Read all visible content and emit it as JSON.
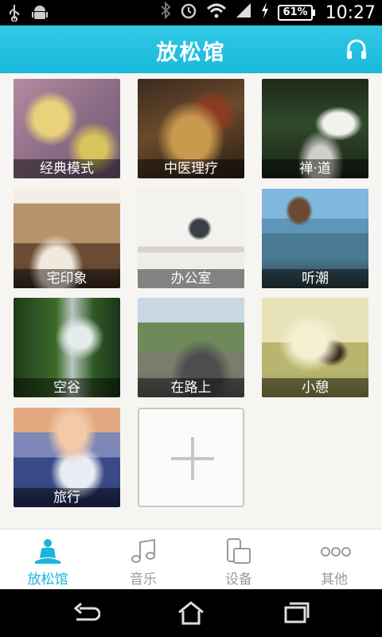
{
  "status_bar": {
    "time": "10:27",
    "battery": "61%",
    "icons": [
      "usb-icon",
      "android-icon",
      "bluetooth-icon",
      "alarm-icon",
      "wifi-icon",
      "signal-icon",
      "charging-icon"
    ]
  },
  "header": {
    "title": "放松馆",
    "right_icon": "headphones-icon"
  },
  "grid": {
    "tiles": [
      {
        "label": "经典模式"
      },
      {
        "label": "中医理疗"
      },
      {
        "label": "禅·道"
      },
      {
        "label": "宅印象"
      },
      {
        "label": "办公室"
      },
      {
        "label": "听潮"
      },
      {
        "label": "空谷"
      },
      {
        "label": "在路上"
      },
      {
        "label": "小憩"
      },
      {
        "label": "旅行"
      }
    ],
    "add_icon": "plus-icon"
  },
  "tabbar": {
    "tabs": [
      {
        "label": "放松馆",
        "icon": "meditation-icon",
        "active": true
      },
      {
        "label": "音乐",
        "icon": "music-note-icon",
        "active": false
      },
      {
        "label": "设备",
        "icon": "devices-icon",
        "active": false
      },
      {
        "label": "其他",
        "icon": "more-icon",
        "active": false
      }
    ]
  },
  "colors": {
    "accent": "#19b6dc",
    "inactive": "#9a9a9a",
    "background": "#f6f5f2"
  }
}
